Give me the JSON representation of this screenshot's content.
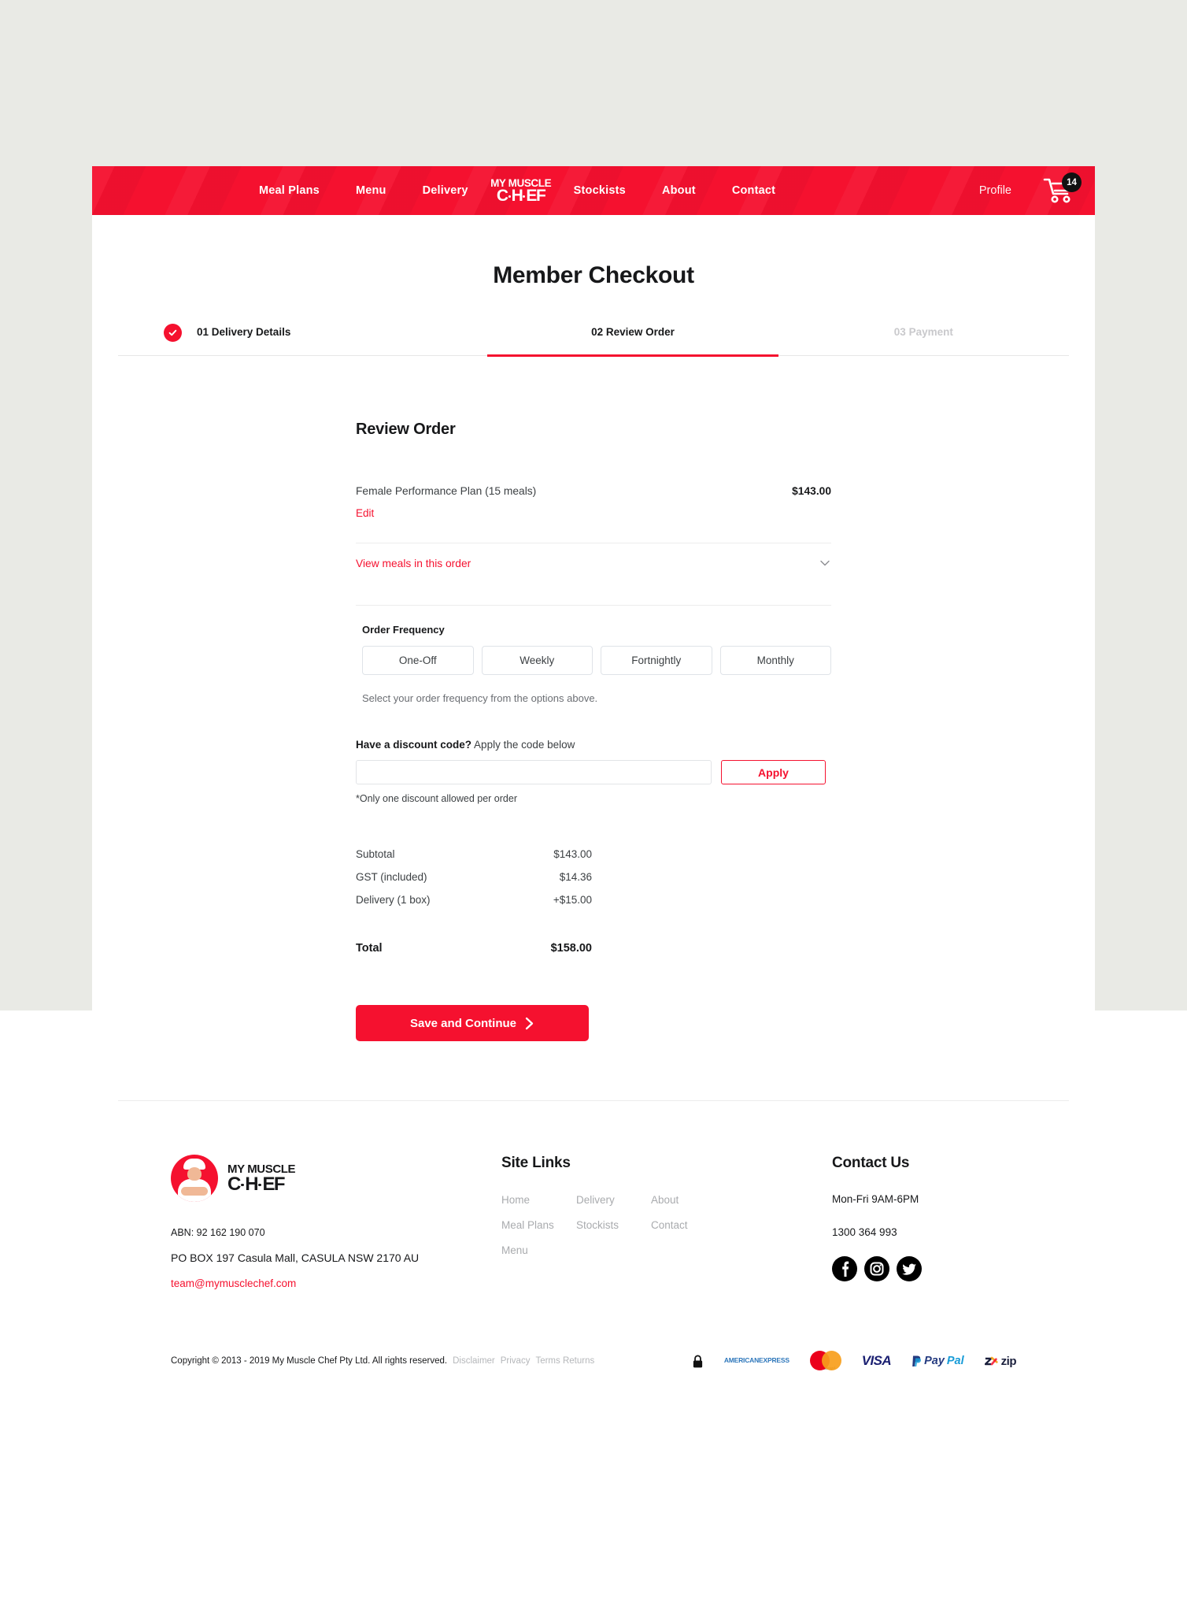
{
  "nav": {
    "links": [
      "Meal Plans",
      "Menu",
      "Delivery"
    ],
    "links_right": [
      "Stockists",
      "About",
      "Contact"
    ],
    "logo_line1": "MY MUSCLE",
    "logo_line2a": "C",
    "logo_line2b": "H",
    "logo_line2c": "EF",
    "profile": "Profile",
    "cart_count": "14",
    "bar_color": "#f5112f"
  },
  "header": {
    "title": "Member Checkout"
  },
  "steps": [
    {
      "label": "01 Delivery Details",
      "state": "complete"
    },
    {
      "label": "02 Review Order",
      "state": "active"
    },
    {
      "label": "03 Payment",
      "state": "upcoming"
    }
  ],
  "review": {
    "section_title": "Review Order",
    "item_name": "Female Performance Plan (15 meals)",
    "item_price": "$143.00",
    "edit_label": "Edit",
    "view_meals_label": "View meals in this order"
  },
  "frequency": {
    "label": "Order Frequency",
    "options": [
      "One-Off",
      "Weekly",
      "Fortnightly",
      "Monthly"
    ],
    "hint": "Select your order frequency from the options above."
  },
  "discount": {
    "label_bold": "Have a discount code?",
    "label_rest": " Apply the code below",
    "input_value": "",
    "input_placeholder": "",
    "apply_label": "Apply",
    "note": "*Only one discount allowed per order"
  },
  "totals": {
    "rows": [
      {
        "label": "Subtotal",
        "value": "$143.00"
      },
      {
        "label": "GST (included)",
        "value": "$14.36"
      },
      {
        "label": "Delivery (1 box)",
        "value": "+$15.00"
      }
    ],
    "grand_label": "Total",
    "grand_value": "$158.00"
  },
  "cta": {
    "save_label": "Save and Continue"
  },
  "footer": {
    "logo_line1": "MY MUSCLE",
    "logo_line2a": "C",
    "logo_line2b": "H",
    "logo_line2c": "EF",
    "abn": "ABN: 92 162 190 070",
    "address": "PO BOX 197 Casula Mall, CASULA NSW 2170 AU",
    "email": "team@mymusclechef.com",
    "site_links_heading": "Site Links",
    "site_links": [
      "Home",
      "Delivery",
      "About",
      "Meal Plans",
      "Stockists",
      "Contact",
      "Menu"
    ],
    "contact_heading": "Contact Us",
    "hours": "Mon-Fri 9AM-6PM",
    "phone": "1300 364 993",
    "socials": [
      "facebook-icon",
      "instagram-icon",
      "twitter-icon"
    ],
    "copyright": "Copyright © 2013 - 2019 My Muscle Chef Pty Ltd. All rights reserved.",
    "legal_links": [
      "Disclaimer",
      "Privacy",
      "Terms Returns"
    ],
    "payment_methods": [
      "secure-lock",
      "american-express",
      "mastercard",
      "visa",
      "paypal",
      "zip"
    ],
    "amex_l1": "AMERICAN",
    "amex_l2": "EXPRESS",
    "mc_label": "mastercard",
    "visa_label": "VISA",
    "paypal_p1": "Pay",
    "paypal_p2": "Pal",
    "zip_label": "zip"
  }
}
